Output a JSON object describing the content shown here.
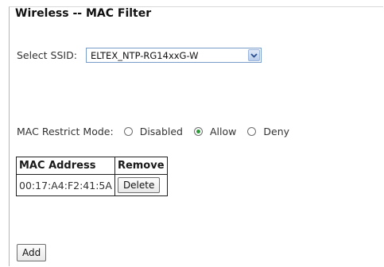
{
  "header": {
    "title": "Wireless -- MAC Filter"
  },
  "ssid": {
    "label": "Select SSID:",
    "selected": "ELTEX_NTP-RG14xxG-W"
  },
  "restrict": {
    "label": "MAC Restrict Mode:",
    "options": [
      {
        "label": "Disabled",
        "checked": false
      },
      {
        "label": "Allow",
        "checked": true
      },
      {
        "label": "Deny",
        "checked": false
      }
    ]
  },
  "table": {
    "headers": [
      "MAC Address",
      "Remove"
    ],
    "rows": [
      {
        "mac": "00:17:A4:F2:41:5A",
        "action": "Delete"
      }
    ]
  },
  "actions": {
    "add_label": "Add"
  },
  "colors": {
    "select_border": "#7a9cc9",
    "radio_checked": "#2d9a3a"
  }
}
